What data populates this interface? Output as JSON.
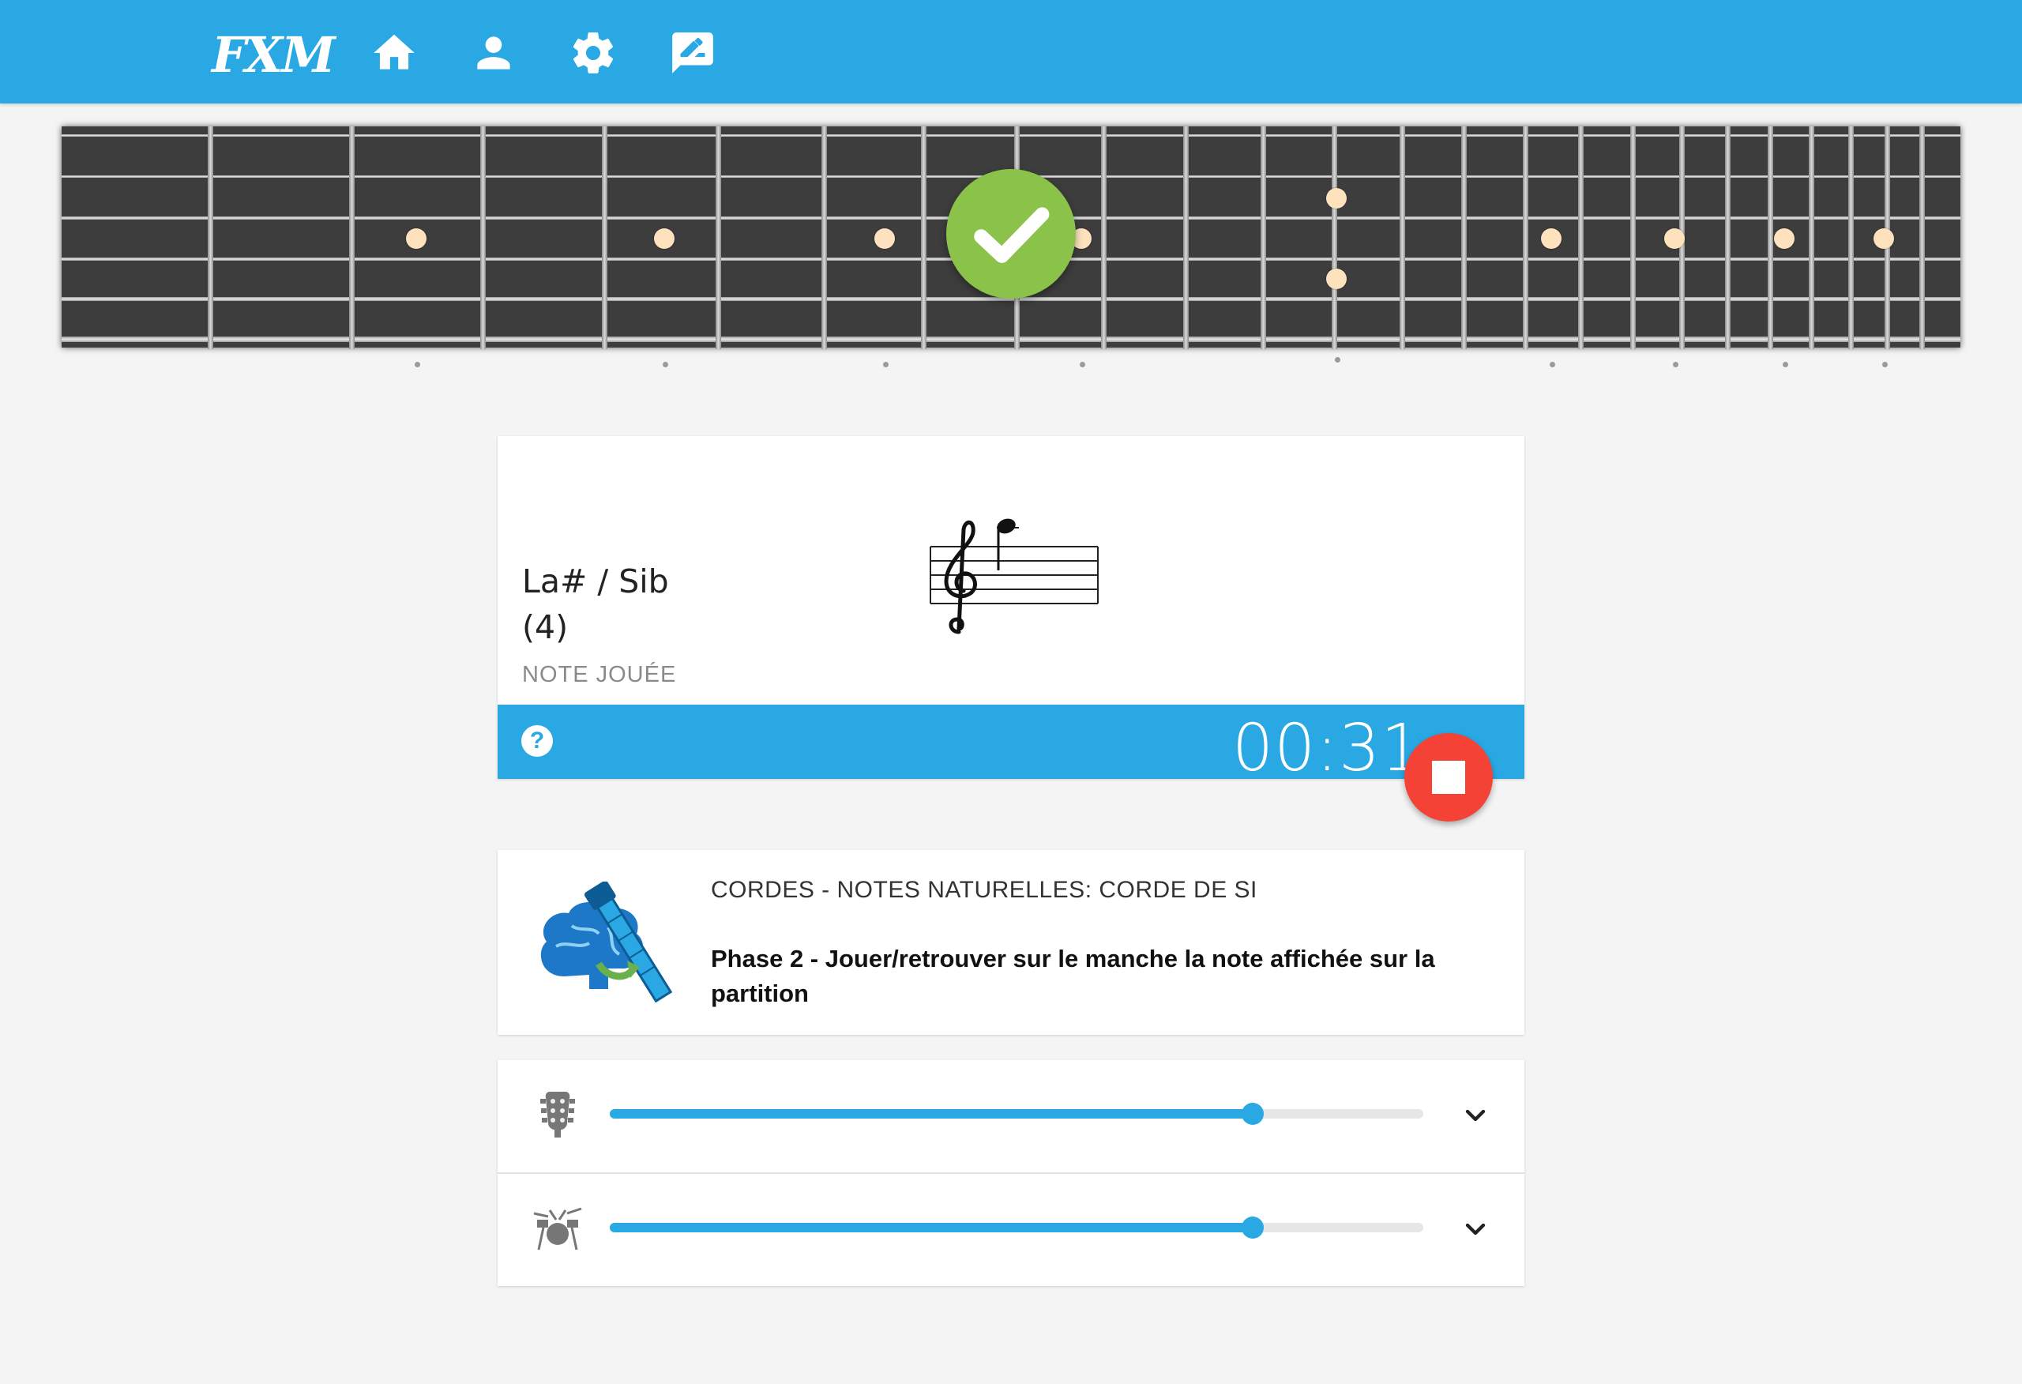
{
  "header": {
    "logo_text": "FXM",
    "nav": [
      {
        "name": "home-icon"
      },
      {
        "name": "account-icon"
      },
      {
        "name": "settings-icon"
      },
      {
        "name": "feedback-icon"
      }
    ],
    "background": "#29a8e4"
  },
  "fretboard": {
    "result_icon": "check-icon",
    "result_color": "#8bc34a"
  },
  "note": {
    "name": "La# / Sib",
    "octave": "(4)",
    "caption": "NOTE JOUÉE",
    "staff_icon": "treble-clef-staff"
  },
  "timer": {
    "value": "00:31",
    "help_label": "?"
  },
  "stop_button": {
    "icon": "stop-icon",
    "color": "#f44336"
  },
  "exercise": {
    "title": "CORDES - NOTES NATURELLES: CORDE DE SI",
    "description": "Phase 2 - Jouer/retrouver sur le manche la note affichée sur la partition",
    "illustration": "brain-guitar-icon"
  },
  "volume": {
    "guitar": {
      "icon": "guitar-headstock-icon",
      "level": 0.79
    },
    "drums": {
      "icon": "drum-kit-icon",
      "level": 0.79
    }
  }
}
